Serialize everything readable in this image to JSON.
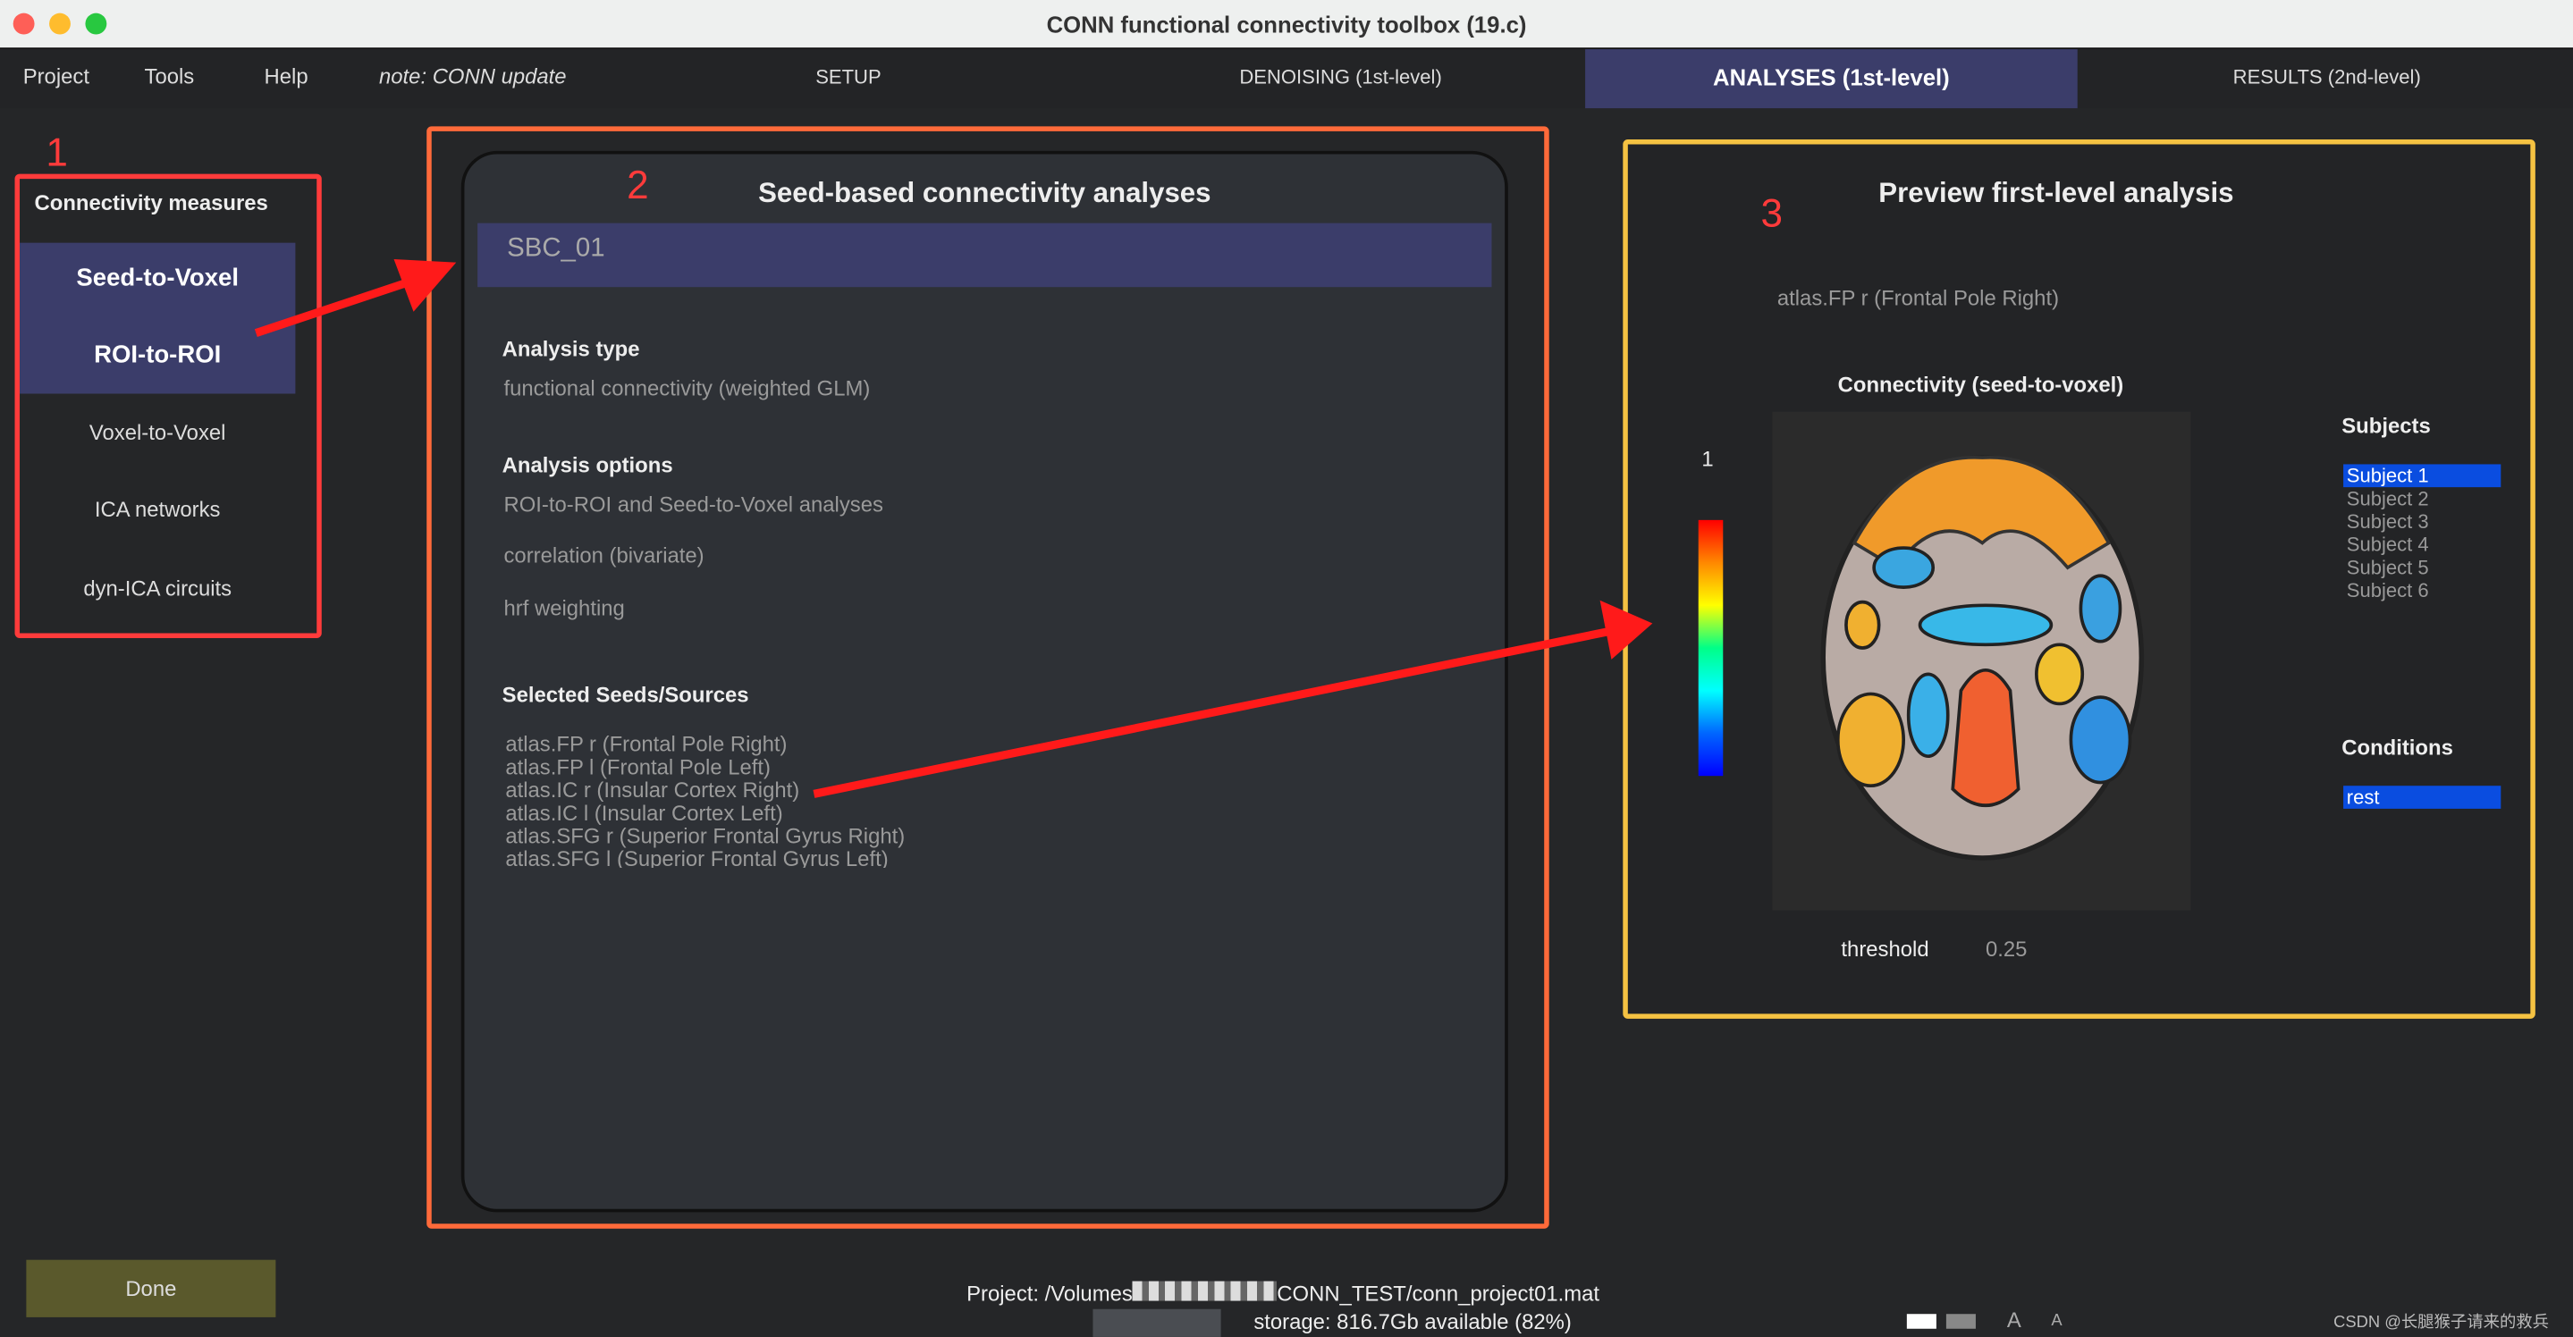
{
  "window": {
    "title": "CONN functional connectivity toolbox (19.c)"
  },
  "menu": {
    "items": [
      "Project",
      "Tools",
      "Help"
    ],
    "note": "note: CONN update"
  },
  "tabs": [
    {
      "label": "SETUP",
      "active": false
    },
    {
      "label": "DENOISING (1st-level)",
      "active": false
    },
    {
      "label": "ANALYSES (1st-level)",
      "active": true
    },
    {
      "label": "RESULTS (2nd-level)",
      "active": false
    }
  ],
  "annotations": {
    "one": "1",
    "two": "2",
    "three": "3"
  },
  "left": {
    "title": "Connectivity measures",
    "items": [
      {
        "label": "Seed-to-Voxel",
        "selected": true
      },
      {
        "label": "ROI-to-ROI",
        "selected": true
      },
      {
        "label": "Voxel-to-Voxel",
        "selected": false
      },
      {
        "label": "ICA networks",
        "selected": false
      },
      {
        "label": "dyn-ICA circuits",
        "selected": false
      }
    ]
  },
  "center": {
    "title": "Seed-based connectivity analyses",
    "name": "SBC_01",
    "analysis_type_label": "Analysis type",
    "analysis_type": "functional connectivity (weighted GLM)",
    "options_label": "Analysis options",
    "options": [
      "ROI-to-ROI and Seed-to-Voxel analyses",
      "correlation (bivariate)",
      "hrf weighting"
    ],
    "seeds_label": "Selected Seeds/Sources",
    "seeds": [
      "atlas.FP r (Frontal Pole Right)",
      "atlas.FP l (Frontal Pole Left)",
      "atlas.IC r (Insular Cortex Right)",
      "atlas.IC l (Insular Cortex Left)",
      "atlas.SFG r (Superior Frontal Gyrus Right)",
      "atlas.SFG l (Superior Frontal Gyrus Left)"
    ]
  },
  "preview": {
    "title": "Preview first-level analysis",
    "seed": "atlas.FP r (Frontal Pole Right)",
    "plot_title": "Connectivity (seed-to-voxel)",
    "colorbar_max": "1",
    "threshold_label": "threshold",
    "threshold_value": "0.25",
    "subjects_label": "Subjects",
    "subjects": [
      "Subject 1",
      "Subject 2",
      "Subject 3",
      "Subject 4",
      "Subject 5",
      "Subject 6"
    ],
    "conditions_label": "Conditions",
    "conditions": [
      "rest"
    ]
  },
  "footer": {
    "done": "Done",
    "project_prefix": "Project: /Volumes",
    "project_suffix": "CONN_TEST/conn_project01.mat",
    "storage": "storage: 816.7Gb available (82%)",
    "font_large": "A",
    "font_small": "A",
    "watermark": "CSDN @长腿猴子请来的救兵"
  },
  "colors": {
    "accent": "#3b3d6a",
    "selection": "#0a4de0",
    "annotation_red": "#ff3b3b",
    "panel_orange": "#ff6a3a",
    "panel_yellow": "#f5c242",
    "done": "#5a592c"
  }
}
